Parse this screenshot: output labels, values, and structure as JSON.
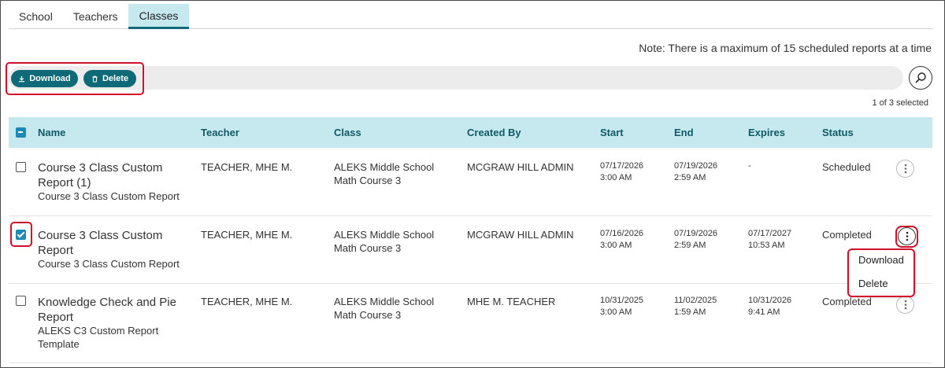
{
  "tabs": [
    {
      "label": "School",
      "active": false
    },
    {
      "label": "Teachers",
      "active": false
    },
    {
      "label": "Classes",
      "active": true
    }
  ],
  "note": "Note: There is a maximum of 15 scheduled reports at a time",
  "toolbar": {
    "download_label": "Download",
    "delete_label": "Delete",
    "download_icon": "download-icon",
    "delete_icon": "trash-icon",
    "search_icon": "search-icon"
  },
  "selected_count": "1 of 3 selected",
  "table": {
    "headers": {
      "name": "Name",
      "teacher": "Teacher",
      "class": "Class",
      "created_by": "Created By",
      "start": "Start",
      "end": "End",
      "expires": "Expires",
      "status": "Status"
    },
    "rows": [
      {
        "checked": false,
        "name_main": "Course 3 Class Custom Report (1)",
        "name_sub": "Course 3 Class Custom Report",
        "teacher": "TEACHER, MHE M.",
        "class": "ALEKS Middle School Math Course 3",
        "created_by": "MCGRAW HILL ADMIN",
        "start_date": "07/17/2026",
        "start_time": "3:00 AM",
        "end_date": "07/19/2026",
        "end_time": "2:59 AM",
        "expires_date": "-",
        "expires_time": "",
        "status": "Scheduled"
      },
      {
        "checked": true,
        "name_main": "Course 3 Class Custom Report",
        "name_sub": "Course 3 Class Custom Report",
        "teacher": "TEACHER, MHE M.",
        "class": "ALEKS Middle School Math Course 3",
        "created_by": "MCGRAW HILL ADMIN",
        "start_date": "07/16/2026",
        "start_time": "3:00 AM",
        "end_date": "07/19/2026",
        "end_time": "2:59 AM",
        "expires_date": "07/17/2027",
        "expires_time": "10:53 AM",
        "status": "Completed"
      },
      {
        "checked": false,
        "name_main": "Knowledge Check and Pie Report",
        "name_sub": "ALEKS C3 Custom Report Template",
        "teacher": "TEACHER, MHE M.",
        "class": "ALEKS Middle School Math Course 3",
        "created_by": "MHE M. TEACHER",
        "start_date": "10/31/2025",
        "start_time": "3:00 AM",
        "end_date": "11/02/2025",
        "end_time": "1:59 AM",
        "expires_date": "10/31/2026",
        "expires_time": "9:41 AM",
        "status": "Completed"
      }
    ]
  },
  "row_menu": {
    "items": [
      "Download",
      "Delete"
    ]
  },
  "colors": {
    "accent": "#0f6a78",
    "header_bg": "#c6e9ef",
    "highlight": "#d1102c",
    "checkbox": "#1e8ab3"
  }
}
